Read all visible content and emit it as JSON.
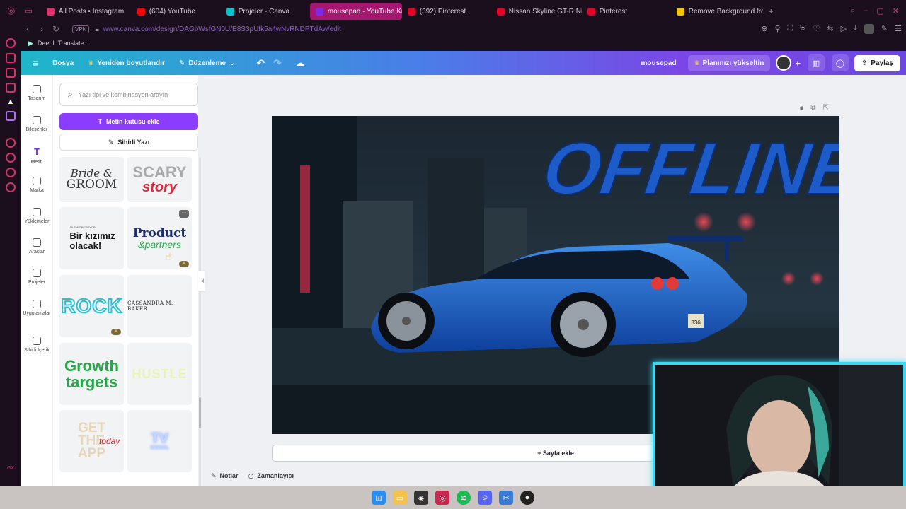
{
  "browser": {
    "tabs": [
      {
        "label": "All Posts • Instagram",
        "color": "#e1306c"
      },
      {
        "label": "(604) YouTube",
        "color": "#ff0000"
      },
      {
        "label": "Projeler - Canva",
        "color": "#00c4cc"
      },
      {
        "label": "mousepad - YouTube Kü",
        "color": "#7d2ae8",
        "active": true
      },
      {
        "label": "(392) Pinterest",
        "color": "#e60023"
      },
      {
        "label": "Nissan Skyline GT-R Nis",
        "color": "#e60023"
      },
      {
        "label": "Pinterest",
        "color": "#e60023"
      },
      {
        "label": "Remove Background from",
        "color": "#f5c400"
      }
    ],
    "new_tab": "+",
    "vpn": "VPN",
    "url": "www.canva.com/design/DAGbWsfGN0U/E8S3pUfk5a4wNvRNDPTdAw/edit",
    "bookmark": "DeepL Translate:..."
  },
  "canva": {
    "menu_file": "Dosya",
    "resize": "Yeniden boyutlandır",
    "editing": "Düzenleme",
    "doc_title": "mousepad",
    "upgrade": "Planınızı yükseltin",
    "share": "Paylaş",
    "rail": [
      {
        "label": "Tasarım",
        "icon": "layout-icon"
      },
      {
        "label": "Bileşenler",
        "icon": "elements-icon"
      },
      {
        "label": "Metin",
        "icon": "text-icon",
        "active": true
      },
      {
        "label": "Marka",
        "icon": "brand-icon"
      },
      {
        "label": "Yüklemeler",
        "icon": "upload-icon"
      },
      {
        "label": "Araçlar",
        "icon": "tools-icon"
      },
      {
        "label": "Projeler",
        "icon": "folder-icon"
      },
      {
        "label": "Uygulamalar",
        "icon": "apps-icon"
      },
      {
        "label": "Sihirli İçerik",
        "icon": "magic-media-icon"
      }
    ],
    "panel": {
      "search_placeholder": "Yazı tipi ve kombinasyon arayın",
      "add_textbox": "Metin kutusu ekle",
      "magic_write": "Sihirli Yazı",
      "tiles": [
        {
          "lines": [
            "Bride &",
            "GROOM"
          ]
        },
        {
          "lines": [
            "SCARY",
            "story"
          ]
        },
        {
          "lines": [
            "AİLEMİZ BÜYÜYOR",
            "Bir kızımız",
            "olacak!"
          ]
        },
        {
          "lines": [
            "Product",
            "&partners"
          ]
        },
        {
          "lines": [
            "ROCK"
          ]
        },
        {
          "lines": [
            "CASSANDRA M. BAKER"
          ]
        },
        {
          "lines": [
            "Growth",
            "targets"
          ]
        },
        {
          "lines": [
            "HUSTLE"
          ]
        },
        {
          "lines": [
            "GET",
            "THE",
            "APP",
            "today"
          ]
        },
        {
          "lines": [
            "TV",
            "SIGNAL"
          ]
        }
      ]
    },
    "design": {
      "headline": "OFFLINE",
      "plate": "336"
    },
    "add_page": "+ Sayfa ekle",
    "notes": "Notlar",
    "timer": "Zamanlayıcı"
  },
  "sidebar_gx": "GX",
  "colors": {
    "accent": "#8b3dff",
    "gx": "#d6336c",
    "cam": "#39d9f0"
  }
}
